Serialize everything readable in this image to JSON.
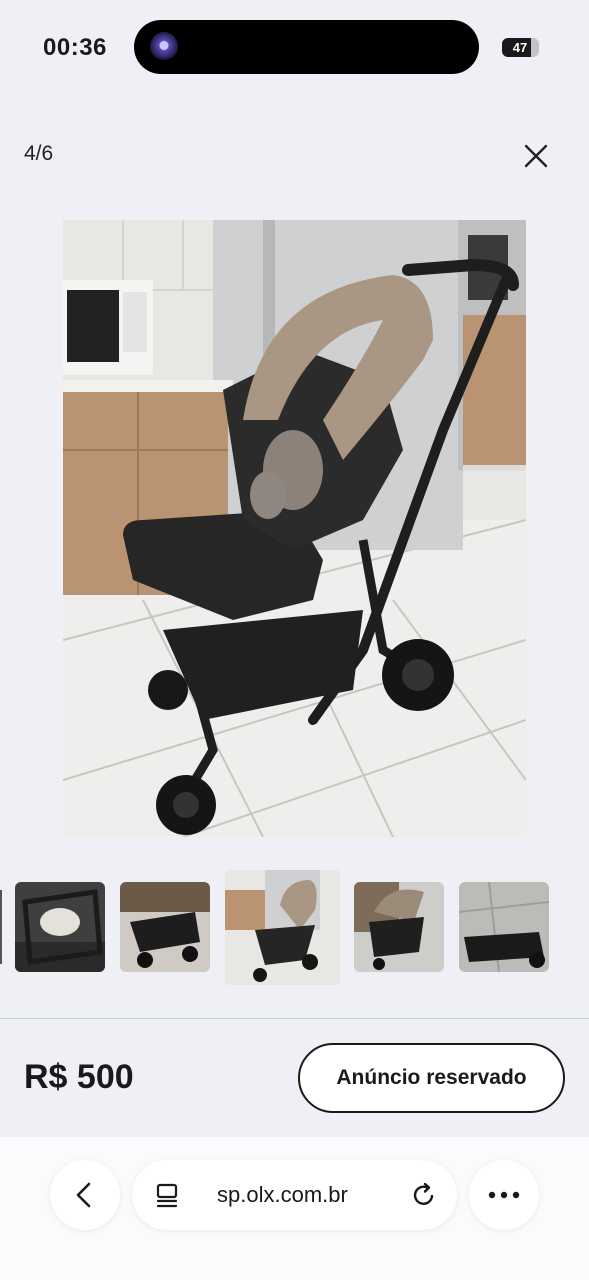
{
  "status_bar": {
    "time": "00:36",
    "battery": "47"
  },
  "header": {
    "counter": "4/6"
  },
  "gallery": {
    "thumbnails": [
      {
        "label": "photo-2",
        "active": false
      },
      {
        "label": "photo-3",
        "active": false
      },
      {
        "label": "photo-4",
        "active": true
      },
      {
        "label": "photo-5",
        "active": false
      },
      {
        "label": "photo-6",
        "active": false
      }
    ]
  },
  "listing": {
    "price": "R$ 500",
    "status_button": "Anúncio reservado"
  },
  "browser": {
    "url": "sp.olx.com.br",
    "icons": [
      "chevron-left-icon",
      "page-settings-icon",
      "reload-icon",
      "more-icon"
    ]
  }
}
